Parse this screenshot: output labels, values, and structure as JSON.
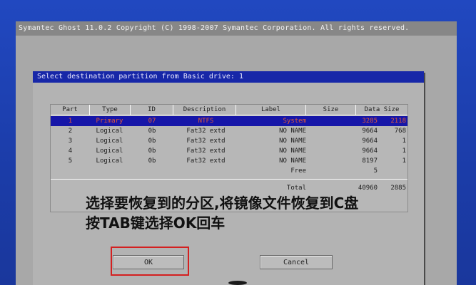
{
  "window": {
    "title": "Symantec Ghost 11.0.2   Copyright (C) 1998-2007 Symantec Corporation. All rights reserved."
  },
  "dialog": {
    "title": "Select destination partition from Basic drive: 1",
    "columns": [
      "Part",
      "Type",
      "ID",
      "Description",
      "Label",
      "Size",
      "Data Size"
    ],
    "rows": [
      {
        "part": "1",
        "type": "Primary",
        "id": "07",
        "description": "NTFS",
        "label": "System",
        "size": "3285",
        "data_size": "2118",
        "selected": true
      },
      {
        "part": "2",
        "type": "Logical",
        "id": "0b",
        "description": "Fat32 extd",
        "label": "NO NAME",
        "size": "9664",
        "data_size": "768"
      },
      {
        "part": "3",
        "type": "Logical",
        "id": "0b",
        "description": "Fat32 extd",
        "label": "NO NAME",
        "size": "9664",
        "data_size": "1"
      },
      {
        "part": "4",
        "type": "Logical",
        "id": "0b",
        "description": "Fat32 extd",
        "label": "NO NAME",
        "size": "9664",
        "data_size": "1"
      },
      {
        "part": "5",
        "type": "Logical",
        "id": "0b",
        "description": "Fat32 extd",
        "label": "NO NAME",
        "size": "8197",
        "data_size": "1"
      }
    ],
    "free_row": {
      "label": "Free",
      "size": "5"
    },
    "total_row": {
      "label": "Total",
      "size": "40960",
      "data_size": "2885"
    },
    "ok_label": "OK",
    "cancel_label": "Cancel"
  },
  "annotation": {
    "line1": "选择要恢复到的分区,将镜像文件恢复到C盘",
    "line2": "按TAB键选择OK回车"
  },
  "colors": {
    "desktop": "#1e3fae",
    "selection": "#1616a8",
    "highlight_box": "#d42020"
  }
}
